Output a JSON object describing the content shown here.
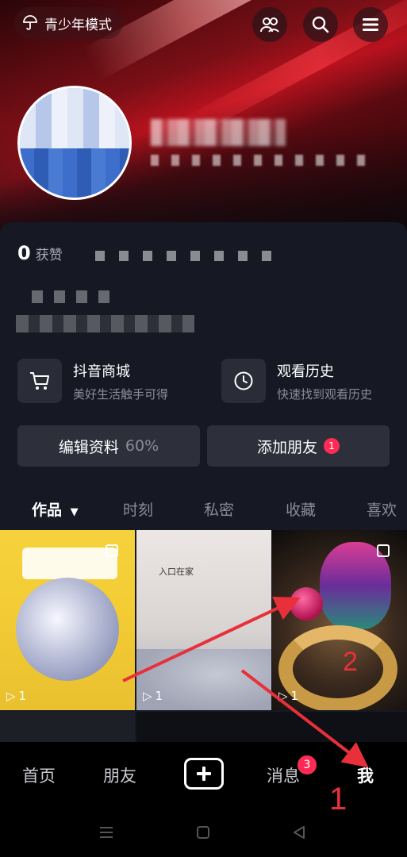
{
  "header": {
    "teen_mode_label": "青少年模式",
    "icons": [
      "umbrella-icon",
      "friends-icon",
      "search-icon",
      "menu-icon"
    ]
  },
  "profile": {
    "likes_count": "0",
    "likes_label": "获赞"
  },
  "features": [
    {
      "title": "抖音商城",
      "subtitle": "美好生活触手可得",
      "icon": "cart-icon"
    },
    {
      "title": "观看历史",
      "subtitle": "快速找到观看历史",
      "icon": "clock-icon"
    }
  ],
  "actions": {
    "edit_label": "编辑资料",
    "edit_progress": "60%",
    "add_friend_label": "添加朋友",
    "add_friend_badge": "1"
  },
  "tabs": [
    {
      "label": "作品",
      "active": true
    },
    {
      "label": "时刻",
      "active": false
    },
    {
      "label": "私密",
      "active": false
    },
    {
      "label": "收藏",
      "active": false
    },
    {
      "label": "喜欢",
      "active": false
    }
  ],
  "grid": [
    {
      "play_count": "1"
    },
    {
      "play_count": "1",
      "overlay_text": "入口在家"
    },
    {
      "play_count": "1"
    }
  ],
  "nav": {
    "home": "首页",
    "friends": "朋友",
    "messages": "消息",
    "messages_badge": "3",
    "me": "我"
  },
  "annotations": {
    "label_1": "1",
    "label_2": "2",
    "color": "#e8303a"
  },
  "colors": {
    "accent": "#fe2c55",
    "card_bg": "#161823"
  }
}
